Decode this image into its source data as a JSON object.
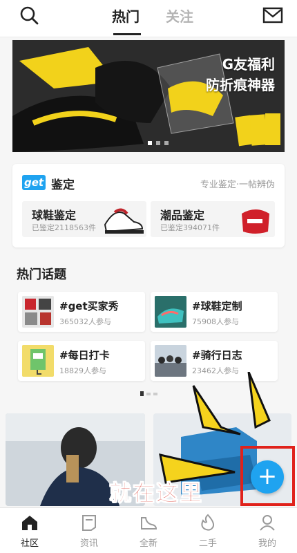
{
  "header": {
    "tabs": [
      {
        "label": "热门",
        "active": true
      },
      {
        "label": "关注",
        "active": false
      }
    ],
    "icons": [
      "search-icon",
      "mail-icon"
    ]
  },
  "banner": {
    "line1": "G友福利",
    "line2": "防折痕神器",
    "slides": 3,
    "active_slide": 1
  },
  "appraisal": {
    "logo": "get",
    "title": "鉴定",
    "subtitle": "专业鉴定·一帖辨伪",
    "items": [
      {
        "title": "球鞋鉴定",
        "count": "已鉴定2118563件"
      },
      {
        "title": "潮品鉴定",
        "count": "已鉴定394071件"
      }
    ]
  },
  "topics": {
    "title": "热门话题",
    "items": [
      {
        "name": "#get买家秀",
        "count": "365032人参与"
      },
      {
        "name": "#球鞋定制",
        "count": "75908人参与"
      },
      {
        "name": "#每日打卡",
        "count": "18829人参与"
      },
      {
        "name": "#骑行日志",
        "count": "23462人参与"
      }
    ]
  },
  "annotation": {
    "text": "就在这里"
  },
  "fab": {
    "label": "+"
  },
  "nav": {
    "items": [
      {
        "label": "社区",
        "icon": "community-icon",
        "active": true
      },
      {
        "label": "资讯",
        "icon": "news-icon",
        "active": false
      },
      {
        "label": "全新",
        "icon": "sneaker-icon",
        "active": false
      },
      {
        "label": "二手",
        "icon": "secondhand-icon",
        "active": false
      },
      {
        "label": "我的",
        "icon": "profile-icon",
        "active": false
      }
    ]
  },
  "colors": {
    "accent": "#1fa3f0",
    "annotation": "#d6281c",
    "banner_yellow": "#f2d21b"
  }
}
